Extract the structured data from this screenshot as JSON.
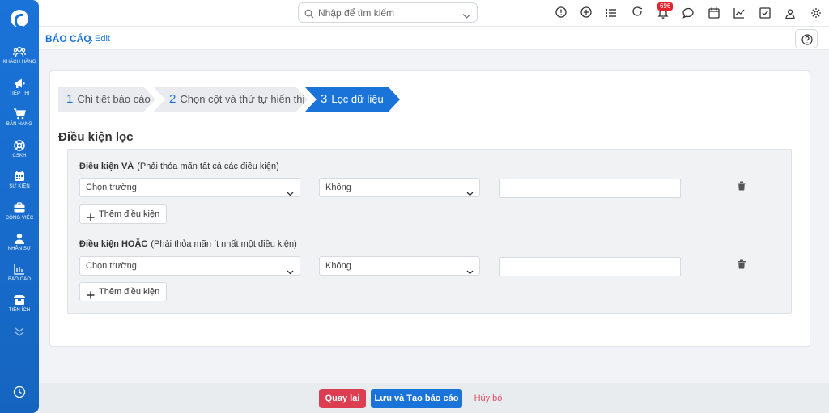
{
  "sidebar": {
    "items": [
      {
        "label": "KHÁCH HÀNG",
        "icon": "users-icon"
      },
      {
        "label": "TIẾP THỊ",
        "icon": "megaphone-icon"
      },
      {
        "label": "BÁN HÀNG",
        "icon": "cart-icon"
      },
      {
        "label": "CSKH",
        "icon": "lifebuoy-icon"
      },
      {
        "label": "SỰ KIỆN",
        "icon": "calendar-icon"
      },
      {
        "label": "CÔNG VIỆC",
        "icon": "briefcase-icon"
      },
      {
        "label": "NHÂN SỰ",
        "icon": "person-icon"
      },
      {
        "label": "BÁO CÁO",
        "icon": "bar-chart-icon"
      },
      {
        "label": "TIỆN ÍCH",
        "icon": "box-icon"
      }
    ]
  },
  "topbar": {
    "search_placeholder": "Nhập để tìm kiếm",
    "notification_count": "696"
  },
  "breadcrumb": {
    "root": "BÁO CÁO",
    "current": "Edit"
  },
  "steps": [
    {
      "num": "1",
      "label": "Chi tiết báo cáo"
    },
    {
      "num": "2",
      "label": "Chọn cột và thứ tự hiển thị"
    },
    {
      "num": "3",
      "label": "Lọc dữ liệu"
    }
  ],
  "filter": {
    "title": "Điều kiện lọc",
    "and_group": {
      "title": "Điều kiện VÀ",
      "hint": "(Phải thỏa mãn tất cả các điều kiện)",
      "field": "Chọn trường",
      "operator": "Không",
      "value": "",
      "add_label": "Thêm điều kiện"
    },
    "or_group": {
      "title": "Điều kiện HOẶC",
      "hint": "(Phải thỏa mãn ít nhất một điều kiện)",
      "field": "Chọn trường",
      "operator": "Không",
      "value": "",
      "add_label": "Thêm điều kiện"
    }
  },
  "footer": {
    "back_label": "Quay lại",
    "save_label": "Lưu và Tạo báo cáo",
    "cancel_label": "Hủy bỏ"
  },
  "colors": {
    "primary": "#1a73d9",
    "danger": "#dc3d50",
    "badge": "#e0242d"
  }
}
